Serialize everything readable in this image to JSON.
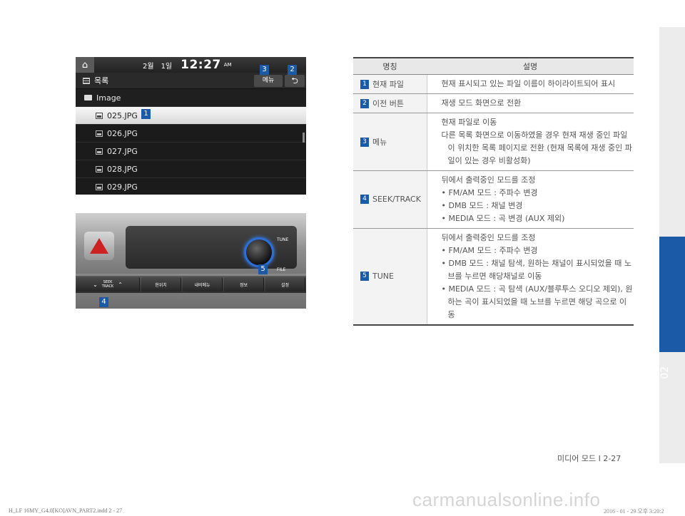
{
  "screen": {
    "status_left": "2월",
    "status_mid": "1일",
    "clock": "12:27",
    "ampm": "AM",
    "header_label": "목록",
    "menu_label": "메뉴",
    "back_icon": "back-arrow-icon",
    "folder_name": "Image",
    "files": [
      "025.JPG",
      "026.JPG",
      "027.JPG",
      "028.JPG",
      "029.JPG"
    ]
  },
  "markers": {
    "m1": "1",
    "m2": "2",
    "m3": "3",
    "m4": "4",
    "m5": "5"
  },
  "panel": {
    "tune_label": "TUNE",
    "file_label": "FILE",
    "seek_line1": "SEEK",
    "seek_line2": "TRACK",
    "buttons": [
      "현위치",
      "내비메뉴",
      "정보",
      "설정"
    ]
  },
  "table": {
    "head_name": "명칭",
    "head_desc": "설명",
    "rows": [
      {
        "num": "1",
        "name": "현재 파일",
        "desc": [
          "현재 표시되고 있는 파일 이름이 하이라이트되어 표시"
        ]
      },
      {
        "num": "2",
        "name": "이전 버튼",
        "desc": [
          "재생 모드 화면으로 전환"
        ]
      },
      {
        "num": "3",
        "name": "메뉴",
        "desc": [
          "현재 파일로 이동",
          "다른 목록 화면으로 이동하였을 경우 현재 재생 중인 파일이 위치한 목록 페이지로 전환 (현재 목록에 재생 중인 파일이 있는 경우 비활성화)"
        ]
      },
      {
        "num": "4",
        "name": "SEEK/TRACK",
        "desc": [
          "뒤에서 출력중인 모드를 조정",
          "• FM/AM 모드 : 주파수 변경",
          "• DMB 모드 : 채널 변경",
          "• MEDIA 모드 : 곡 변경 (AUX 제외)"
        ]
      },
      {
        "num": "5",
        "name": "TUNE",
        "desc": [
          "뒤에서 출력중인 모드를 조정",
          "• FM/AM 모드 : 주파수 변경",
          "• DMB 모드 : 채널 탐색, 원하는 채널이 표시되었을 때 노브를 누르면 해당채널로 이동",
          "• MEDIA 모드 : 곡 탐색 (AUX/블루투스 오디오 제외), 원하는 곡이 표시되었을 때 노브를 누르면 해당 곡으로 이동"
        ]
      }
    ]
  },
  "side_tab": "02",
  "footer": {
    "page": "미디어 모드 I 2-27",
    "file": "H_LF 16MY_G4.0[KO]AVN_PART2.indd   2 - 27",
    "date": "2016 - 01 - 29   오후 3:20:2",
    "watermark": "carmanualsonline.info"
  },
  "colors": {
    "accent": "#1a5aa6",
    "knob_ring": "#2d6fd8",
    "hazard": "#cc2222"
  }
}
